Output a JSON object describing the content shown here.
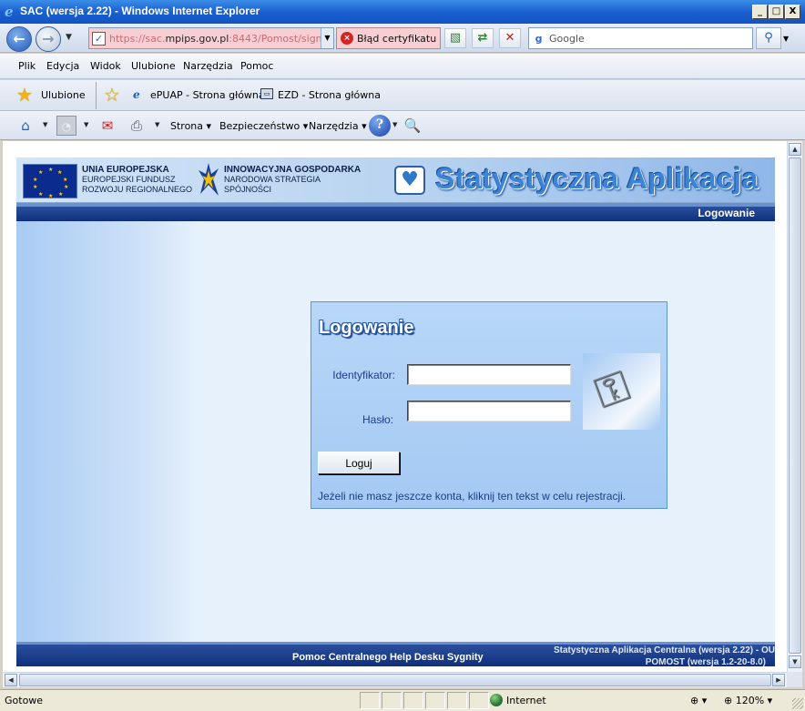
{
  "window": {
    "title": "SAC (wersja 2.22) - Windows Internet Explorer",
    "minimize": "_",
    "maximize": "□",
    "close": "X"
  },
  "address_bar": {
    "url_prefix": "https://sac.",
    "url_domain": "mpips.gov.pl",
    "url_rest": ":8443/Pomost/signin.do",
    "cert_error": "Błąd certyfikatu",
    "search_placeholder": "Google"
  },
  "menu": {
    "items": [
      {
        "label": "Plik"
      },
      {
        "label": "Edycja"
      },
      {
        "label": "Widok"
      },
      {
        "label": "Ulubione"
      },
      {
        "label": "Narzędzia"
      },
      {
        "label": "Pomoc"
      }
    ]
  },
  "favorites_bar": {
    "favorites_label": "Ulubione",
    "links": [
      {
        "label": "ePUAP - Strona główna"
      },
      {
        "label": "EZD - Strona główna"
      }
    ]
  },
  "command_bar": {
    "page_label": "Strona",
    "security_label": "Bezpieczeństwo",
    "tools_label": "Narzędzia"
  },
  "banner": {
    "eu_title": "UNIA EUROPEJSKA",
    "eu_line2": "EUROPEJSKI FUNDUSZ",
    "eu_line3": "ROZWOJU REGIONALNEGO",
    "ig_title": "INNOWACYJNA GOSPODARKA",
    "ig_line2": "NARODOWA STRATEGIA",
    "ig_line3": "SPÓJNOŚCI",
    "app_title": "Statystyczna Aplikacja"
  },
  "navbar": {
    "section_label": "Logowanie"
  },
  "login": {
    "heading": "Logowanie",
    "identifier_label": "Identyfikator:",
    "identifier_value": "",
    "password_label": "Hasło:",
    "password_value": "",
    "submit_label": "Loguj",
    "register_text": "Jeżeli nie masz jeszcze konta, kliknij ten tekst w celu rejestracji."
  },
  "footer": {
    "help_link": "Pomoc Centralnego Help Desku Sygnity",
    "version_line1": "Statystyczna Aplikacja Centralna (wersja 2.22) - OU",
    "version_line2": "POMOST (wersja 1.2-20-8.0)"
  },
  "status_bar": {
    "status": "Gotowe",
    "zone": "Internet",
    "zoom": "120%"
  },
  "colors": {
    "titlebar": "#1a5fcf",
    "nav_dark": "#0f2f7a",
    "login_panel": "#b8d7f8",
    "cert_error_bg": "#f7cfd3"
  }
}
